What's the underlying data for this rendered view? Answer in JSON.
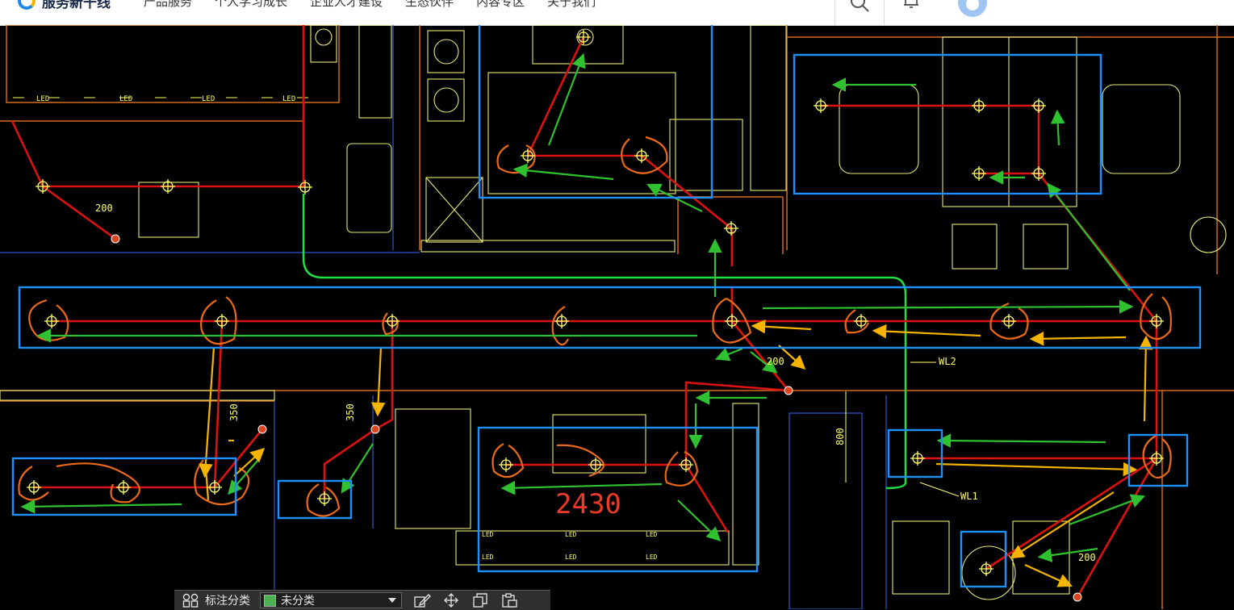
{
  "header": {
    "logo_text": "服务新干线",
    "nav": [
      "产品服务",
      "个人学习成长",
      "企业人才建设",
      "生态伙伴",
      "内容专区",
      "关于我们"
    ]
  },
  "drawing": {
    "dim_labels": [
      "200",
      "350",
      "350",
      "200",
      "800",
      "200"
    ],
    "wire_labels": [
      "WL2",
      "WL1"
    ],
    "big_dimension": "2430",
    "led_label": "LED"
  },
  "toolbar": {
    "category_label": "标注分类",
    "selected_category": "未分类",
    "swatch_color": "#4caf50"
  }
}
